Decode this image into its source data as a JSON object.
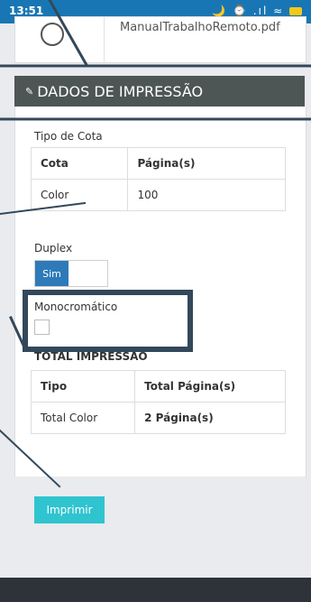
{
  "status_bar": {
    "time": "13:51",
    "icons": "🌙 ⌚ .ıl ≈"
  },
  "file": {
    "name": "ManualTrabalhoRemoto.pdf"
  },
  "section": {
    "title": "DADOS DE IMPRESSÃO"
  },
  "cota": {
    "label": "Tipo de Cota",
    "columns": [
      "Cota",
      "Página(s)"
    ],
    "rows": [
      [
        "Color",
        "100"
      ]
    ]
  },
  "duplex": {
    "label": "Duplex",
    "value": "Sim"
  },
  "mono": {
    "label": "Monocromático"
  },
  "total": {
    "label": "TOTAL IMPRESSÃO",
    "columns": [
      "Tipo",
      "Total Página(s)"
    ],
    "rows": [
      [
        "Total Color",
        "2 Página(s)"
      ]
    ]
  },
  "actions": {
    "print_label": "Imprimir"
  },
  "colors": {
    "header": "#4d5555",
    "print": "#2fc4cf",
    "toggle_on": "#2e7ab8",
    "annotation": "#33485a"
  }
}
